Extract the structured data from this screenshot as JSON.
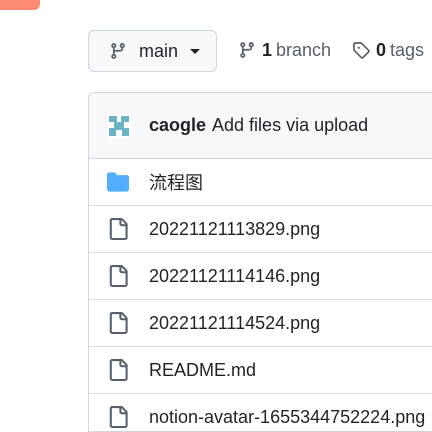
{
  "colors": {
    "accent": "#fd8c73",
    "folder": "#54aeff",
    "icon_gray": "#57606a",
    "border": "#d0d7de"
  },
  "toolbar": {
    "branch_select": {
      "value": "main",
      "icon": "git-branch-icon"
    },
    "branches": {
      "count": "1",
      "label": "branch",
      "icon": "git-branch-icon"
    },
    "tags": {
      "count": "0",
      "label": "tags",
      "icon": "tag-icon"
    }
  },
  "commit": {
    "author": "caogle",
    "message": "Add files via upload"
  },
  "files": [
    {
      "name": "流程图",
      "type": "folder",
      "icon": "folder-icon"
    },
    {
      "name": "20221121113829.png",
      "type": "file",
      "icon": "file-icon"
    },
    {
      "name": "20221121114146.png",
      "type": "file",
      "icon": "file-icon"
    },
    {
      "name": "20221121114524.png",
      "type": "file",
      "icon": "file-icon"
    },
    {
      "name": "README.md",
      "type": "file",
      "icon": "file-icon"
    },
    {
      "name": "notion-avatar-1655344752224.png",
      "type": "file",
      "icon": "file-icon"
    }
  ]
}
